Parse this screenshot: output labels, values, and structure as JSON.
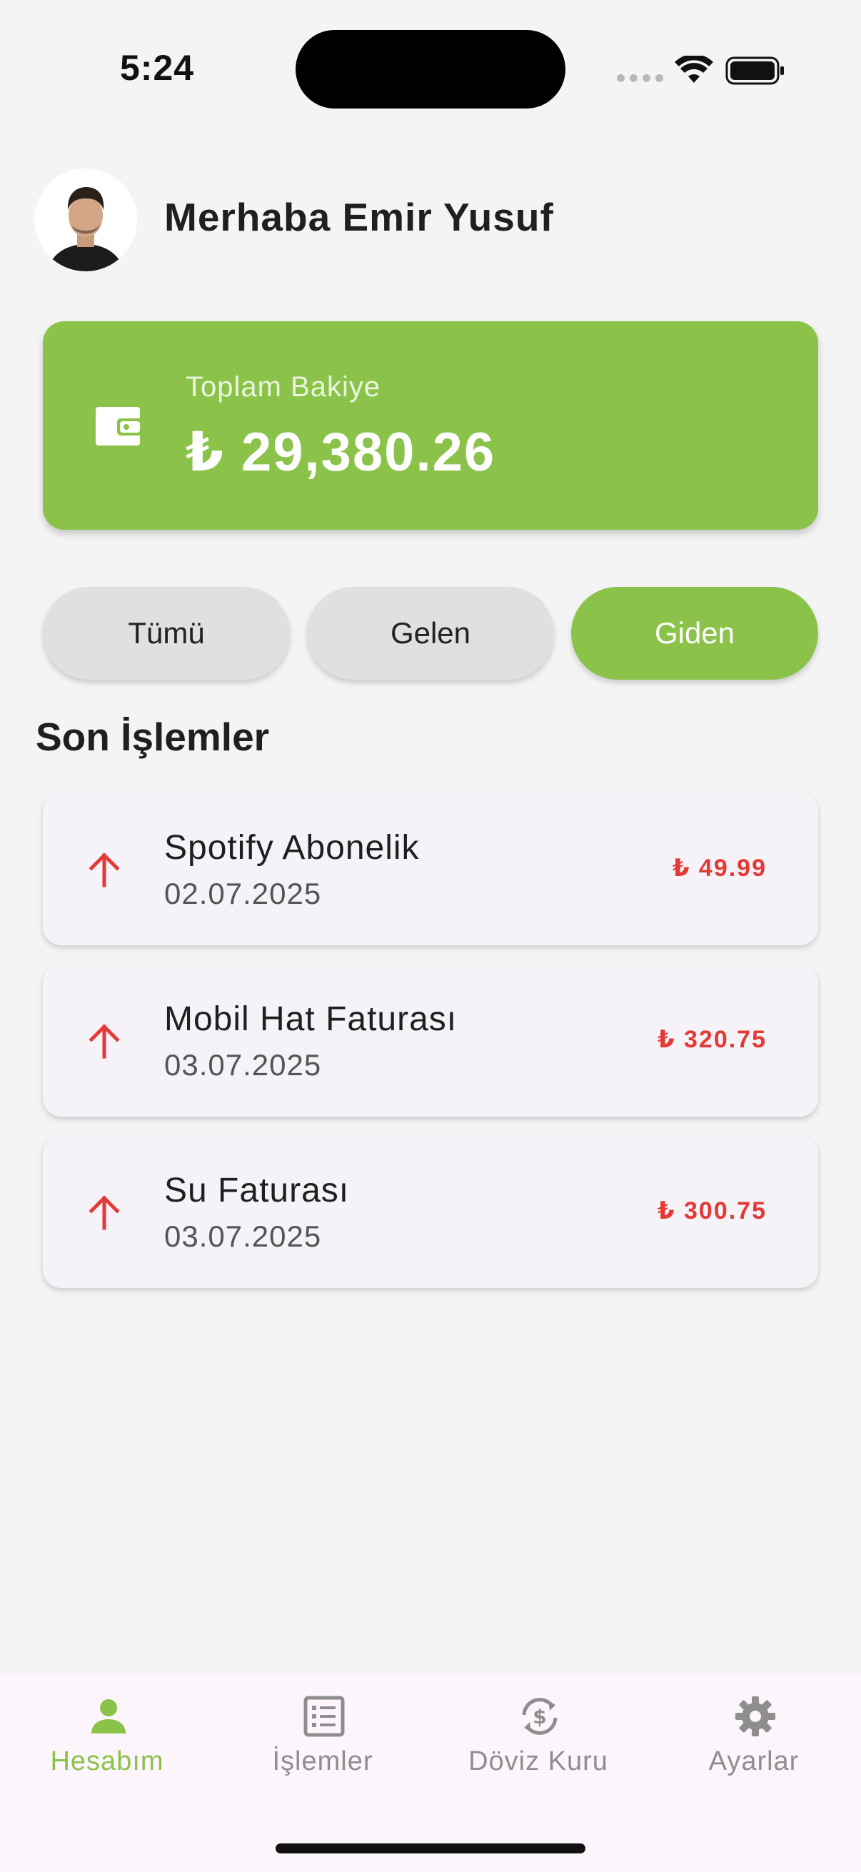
{
  "status_bar": {
    "time": "5:24"
  },
  "header": {
    "greeting": "Merhaba Emir Yusuf"
  },
  "balance": {
    "label": "Toplam Bakiye",
    "amount": "₺ 29,380.26"
  },
  "filters": [
    {
      "label": "Tümü",
      "active": false
    },
    {
      "label": "Gelen",
      "active": false
    },
    {
      "label": "Giden",
      "active": true
    }
  ],
  "section_title": "Son İşlemler",
  "transactions": [
    {
      "title": "Spotify Abonelik",
      "date": "02.07.2025",
      "amount": "₺ 49.99",
      "direction": "outgoing"
    },
    {
      "title": "Mobil Hat Faturası",
      "date": "03.07.2025",
      "amount": "₺ 320.75",
      "direction": "outgoing"
    },
    {
      "title": "Su Faturası",
      "date": "03.07.2025",
      "amount": "₺ 300.75",
      "direction": "outgoing"
    }
  ],
  "nav": [
    {
      "label": "Hesabım",
      "icon": "person-icon",
      "active": true
    },
    {
      "label": "İşlemler",
      "icon": "list-icon",
      "active": false
    },
    {
      "label": "Döviz Kuru",
      "icon": "currency-exchange-icon",
      "active": false
    },
    {
      "label": "Ayarlar",
      "icon": "gear-icon",
      "active": false
    }
  ],
  "colors": {
    "accent": "#8bc34a",
    "outgoing": "#e53935",
    "background": "#f4f4f4"
  }
}
